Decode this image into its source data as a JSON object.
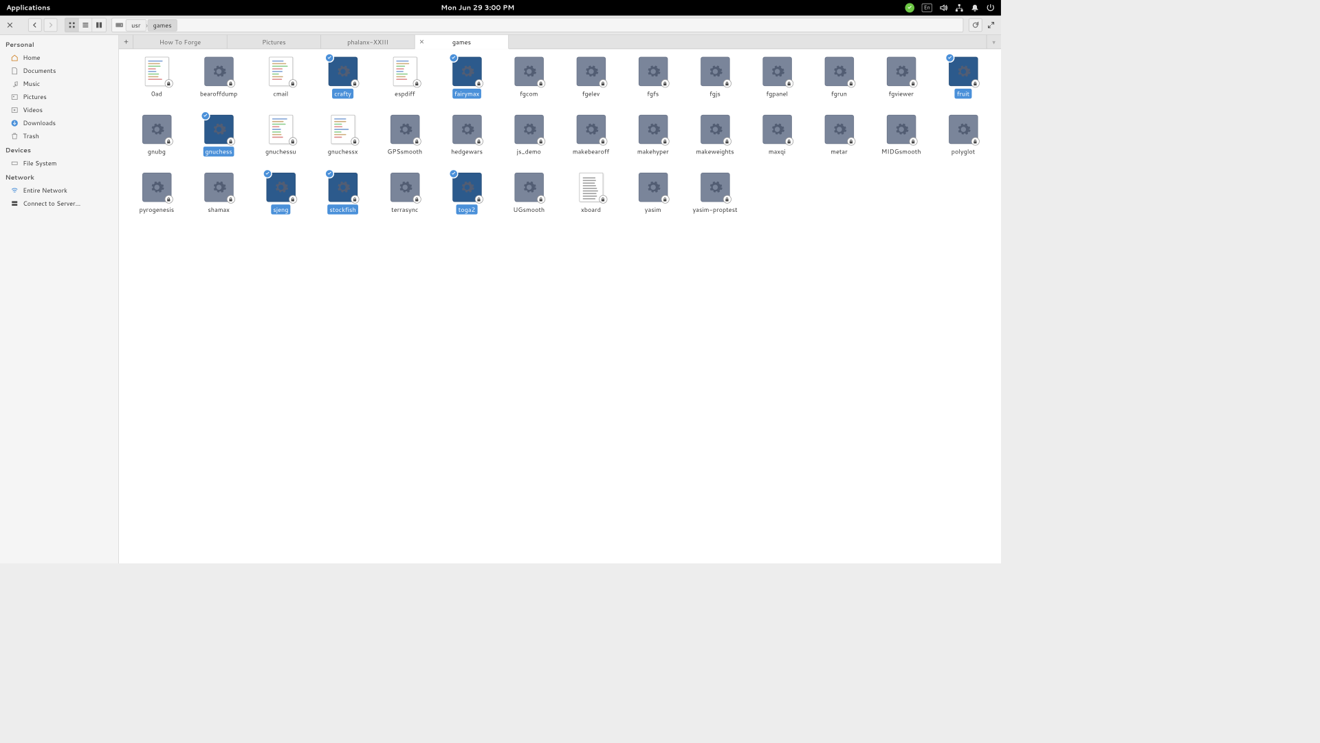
{
  "panel": {
    "applications": "Applications",
    "datetime": "Mon Jun 29   3:00 PM",
    "lang": "En"
  },
  "toolbar": {
    "path": [
      "usr",
      "games"
    ]
  },
  "sidebar": {
    "personal": {
      "header": "Personal",
      "items": [
        "Home",
        "Documents",
        "Music",
        "Pictures",
        "Videos",
        "Downloads",
        "Trash"
      ]
    },
    "devices": {
      "header": "Devices",
      "items": [
        "File System"
      ]
    },
    "network": {
      "header": "Network",
      "items": [
        "Entire Network",
        "Connect to Server..."
      ]
    }
  },
  "tabs": [
    {
      "label": "How To Forge",
      "active": false
    },
    {
      "label": "Pictures",
      "active": false
    },
    {
      "label": "phalanx-XXIII",
      "active": false
    },
    {
      "label": "games",
      "active": true
    }
  ],
  "files": [
    {
      "name": "0ad",
      "type": "script",
      "selected": false
    },
    {
      "name": "bearoffdump",
      "type": "exec",
      "selected": false
    },
    {
      "name": "cmail",
      "type": "script",
      "selected": false
    },
    {
      "name": "crafty",
      "type": "exec",
      "selected": true
    },
    {
      "name": "espdiff",
      "type": "script",
      "selected": false
    },
    {
      "name": "fairymax",
      "type": "exec",
      "selected": true
    },
    {
      "name": "fgcom",
      "type": "exec",
      "selected": false
    },
    {
      "name": "fgelev",
      "type": "exec",
      "selected": false
    },
    {
      "name": "fgfs",
      "type": "exec",
      "selected": false
    },
    {
      "name": "fgjs",
      "type": "exec",
      "selected": false
    },
    {
      "name": "fgpanel",
      "type": "exec",
      "selected": false
    },
    {
      "name": "fgrun",
      "type": "exec",
      "selected": false
    },
    {
      "name": "fgviewer",
      "type": "exec",
      "selected": false
    },
    {
      "name": "fruit",
      "type": "exec",
      "selected": true
    },
    {
      "name": "gnubg",
      "type": "exec",
      "selected": false
    },
    {
      "name": "gnuchess",
      "type": "exec",
      "selected": true
    },
    {
      "name": "gnuchessu",
      "type": "script",
      "selected": false
    },
    {
      "name": "gnuchessx",
      "type": "script",
      "selected": false
    },
    {
      "name": "GPSsmooth",
      "type": "exec",
      "selected": false
    },
    {
      "name": "hedgewars",
      "type": "exec",
      "selected": false
    },
    {
      "name": "js_demo",
      "type": "exec",
      "selected": false
    },
    {
      "name": "makebearoff",
      "type": "exec",
      "selected": false
    },
    {
      "name": "makehyper",
      "type": "exec",
      "selected": false
    },
    {
      "name": "makeweights",
      "type": "exec",
      "selected": false
    },
    {
      "name": "maxqi",
      "type": "exec",
      "selected": false
    },
    {
      "name": "metar",
      "type": "exec",
      "selected": false
    },
    {
      "name": "MIDGsmooth",
      "type": "exec",
      "selected": false
    },
    {
      "name": "polyglot",
      "type": "exec",
      "selected": false
    },
    {
      "name": "pyrogenesis",
      "type": "exec",
      "selected": false
    },
    {
      "name": "shamax",
      "type": "exec",
      "selected": false
    },
    {
      "name": "sjeng",
      "type": "exec",
      "selected": true
    },
    {
      "name": "stockfish",
      "type": "exec",
      "selected": true
    },
    {
      "name": "terrasync",
      "type": "exec",
      "selected": false
    },
    {
      "name": "toga2",
      "type": "exec",
      "selected": true
    },
    {
      "name": "UGsmooth",
      "type": "exec",
      "selected": false
    },
    {
      "name": "xboard",
      "type": "page",
      "selected": false
    },
    {
      "name": "yasim",
      "type": "exec",
      "selected": false
    },
    {
      "name": "yasim-proptest",
      "type": "exec",
      "selected": false
    }
  ]
}
